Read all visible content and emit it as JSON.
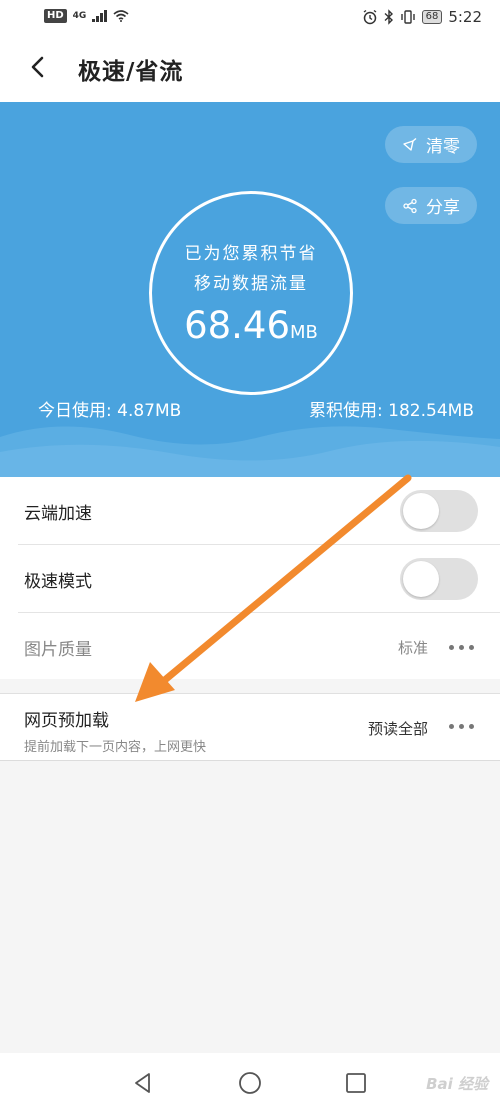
{
  "status_bar": {
    "hd_badge": "HD",
    "network": "4G",
    "battery": "68",
    "time": "5:22"
  },
  "header": {
    "title": "极速/省流"
  },
  "hero": {
    "circle_line1": "已为您累积节省",
    "circle_line2": "移动数据流量",
    "saved_value": "68.46",
    "saved_unit": "MB",
    "clear_label": "清零",
    "share_label": "分享",
    "today_usage": "今日使用: 4.87MB",
    "total_usage": "累积使用: 182.54MB",
    "background_color": "#4aa3de"
  },
  "settings": {
    "items": [
      {
        "label": "云端加速",
        "toggle": false
      },
      {
        "label": "极速模式",
        "toggle": false
      },
      {
        "label": "图片质量",
        "value": "标准"
      }
    ]
  },
  "preload": {
    "label": "网页预加载",
    "description": "提前加载下一页内容，上网更快",
    "value": "预读全部"
  },
  "annotation": {
    "arrow_color": "#f28a2e"
  },
  "nav": {
    "watermark": "Bai 经验"
  }
}
